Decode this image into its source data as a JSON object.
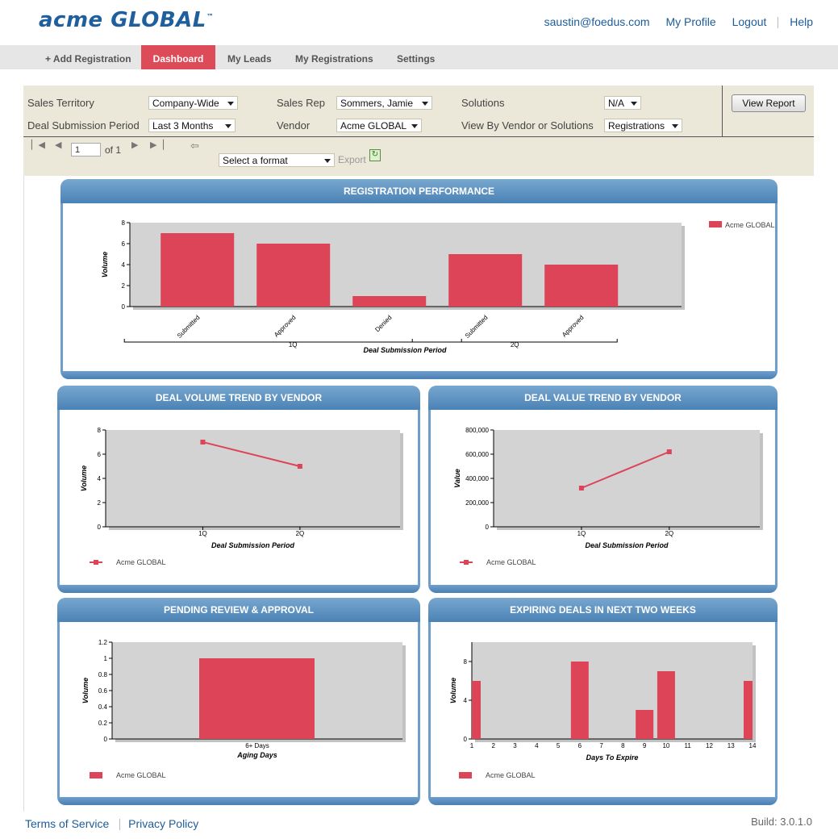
{
  "app": {
    "logo_main": "acme GLOBAL",
    "logo_mark": "™"
  },
  "toplinks": {
    "email": "saustin@foedus.com",
    "profile": "My Profile",
    "logout": "Logout",
    "help": "Help"
  },
  "nav": {
    "add_registration": "+ Add Registration",
    "dashboard": "Dashboard",
    "my_leads": "My Leads",
    "my_registrations": "My Registrations",
    "settings": "Settings"
  },
  "filters": {
    "sales_territory": {
      "label": "Sales Territory",
      "value": "Company-Wide"
    },
    "deal_period": {
      "label": "Deal Submission Period",
      "value": "Last 3 Months"
    },
    "sales_rep": {
      "label": "Sales Rep",
      "value": "Sommers, Jamie"
    },
    "vendor": {
      "label": "Vendor",
      "value": "Acme GLOBAL"
    },
    "solutions": {
      "label": "Solutions",
      "value": "N/A"
    },
    "view_by": {
      "label": "View By Vendor or Solutions",
      "value": "Registrations"
    },
    "view_report": "View Report"
  },
  "pager": {
    "page": "1",
    "of_label": "of 1",
    "format_placeholder": "Select a format",
    "export_label": "Export"
  },
  "footer": {
    "terms": "Terms of Service",
    "privacy": "Privacy Policy",
    "build": "Build: 3.0.1.0"
  },
  "colors": {
    "series": "#dd4458",
    "plot_bg": "#d3d3d3",
    "panel_header": "#5a8fc2",
    "nav_active": "#dd4a58"
  },
  "chart_data": [
    {
      "id": "registration-performance",
      "panel_title": "REGISTRATION PERFORMANCE",
      "type": "bar",
      "categories": [
        "Submitted",
        "Approved",
        "Denied",
        "Submitted",
        "Approved"
      ],
      "groups": [
        {
          "label": "1Q",
          "count": 3
        },
        {
          "label": "2Q",
          "count": 2
        }
      ],
      "series": [
        {
          "name": "Acme GLOBAL",
          "values": [
            7,
            6,
            1,
            5,
            4
          ]
        }
      ],
      "ylabel": "Volume",
      "xlabel": "Deal Submission Period",
      "ylim": [
        0,
        8
      ],
      "yticks": [
        "0",
        "2",
        "4",
        "6",
        "8"
      ],
      "legend": "right"
    },
    {
      "id": "deal-volume-trend",
      "panel_title": "DEAL VOLUME TREND BY VENDOR",
      "type": "line",
      "x": [
        "1Q",
        "2Q"
      ],
      "series": [
        {
          "name": "Acme GLOBAL",
          "values": [
            7,
            5
          ]
        }
      ],
      "ylabel": "Volume",
      "xlabel": "Deal Submission Period",
      "ylim": [
        0,
        8
      ],
      "yticks": [
        "0",
        "2",
        "4",
        "6",
        "8"
      ],
      "legend": "bottom-left"
    },
    {
      "id": "deal-value-trend",
      "panel_title": "DEAL VALUE TREND BY VENDOR",
      "type": "line",
      "x": [
        "1Q",
        "2Q"
      ],
      "series": [
        {
          "name": "Acme GLOBAL",
          "values": [
            320000,
            620000
          ]
        }
      ],
      "ylabel": "Value",
      "xlabel": "Deal Submission Period",
      "ylim": [
        0,
        800000
      ],
      "yticks": [
        "0",
        "200,000",
        "400,000",
        "600,000",
        "800,000"
      ],
      "legend": "bottom-left"
    },
    {
      "id": "pending-review",
      "panel_title": "PENDING REVIEW & APPROVAL",
      "type": "bar",
      "categories": [
        "6+ Days"
      ],
      "series": [
        {
          "name": "Acme GLOBAL",
          "values": [
            1
          ]
        }
      ],
      "ylabel": "Volume",
      "xlabel": "Aging Days",
      "ylim": [
        0,
        1.2
      ],
      "yticks": [
        "0",
        "0.2",
        "0.4",
        "0.6",
        "0.8",
        "1",
        "1.2"
      ],
      "legend": "bottom-left"
    },
    {
      "id": "expiring-deals",
      "panel_title": "EXPIRING DEALS IN NEXT TWO WEEKS",
      "type": "bar",
      "categories": [
        "1",
        "2",
        "3",
        "4",
        "5",
        "6",
        "7",
        "8",
        "9",
        "10",
        "11",
        "12",
        "13",
        "14"
      ],
      "series": [
        {
          "name": "Acme GLOBAL",
          "values": [
            6,
            0,
            0,
            0,
            0,
            8,
            0,
            0,
            3,
            7,
            0,
            0,
            0,
            6
          ]
        }
      ],
      "ylabel": "Volume",
      "xlabel": "Days To Expire",
      "ylim": [
        0,
        10
      ],
      "yticks": [
        "0",
        "4",
        "8"
      ],
      "legend": "bottom-left"
    }
  ]
}
